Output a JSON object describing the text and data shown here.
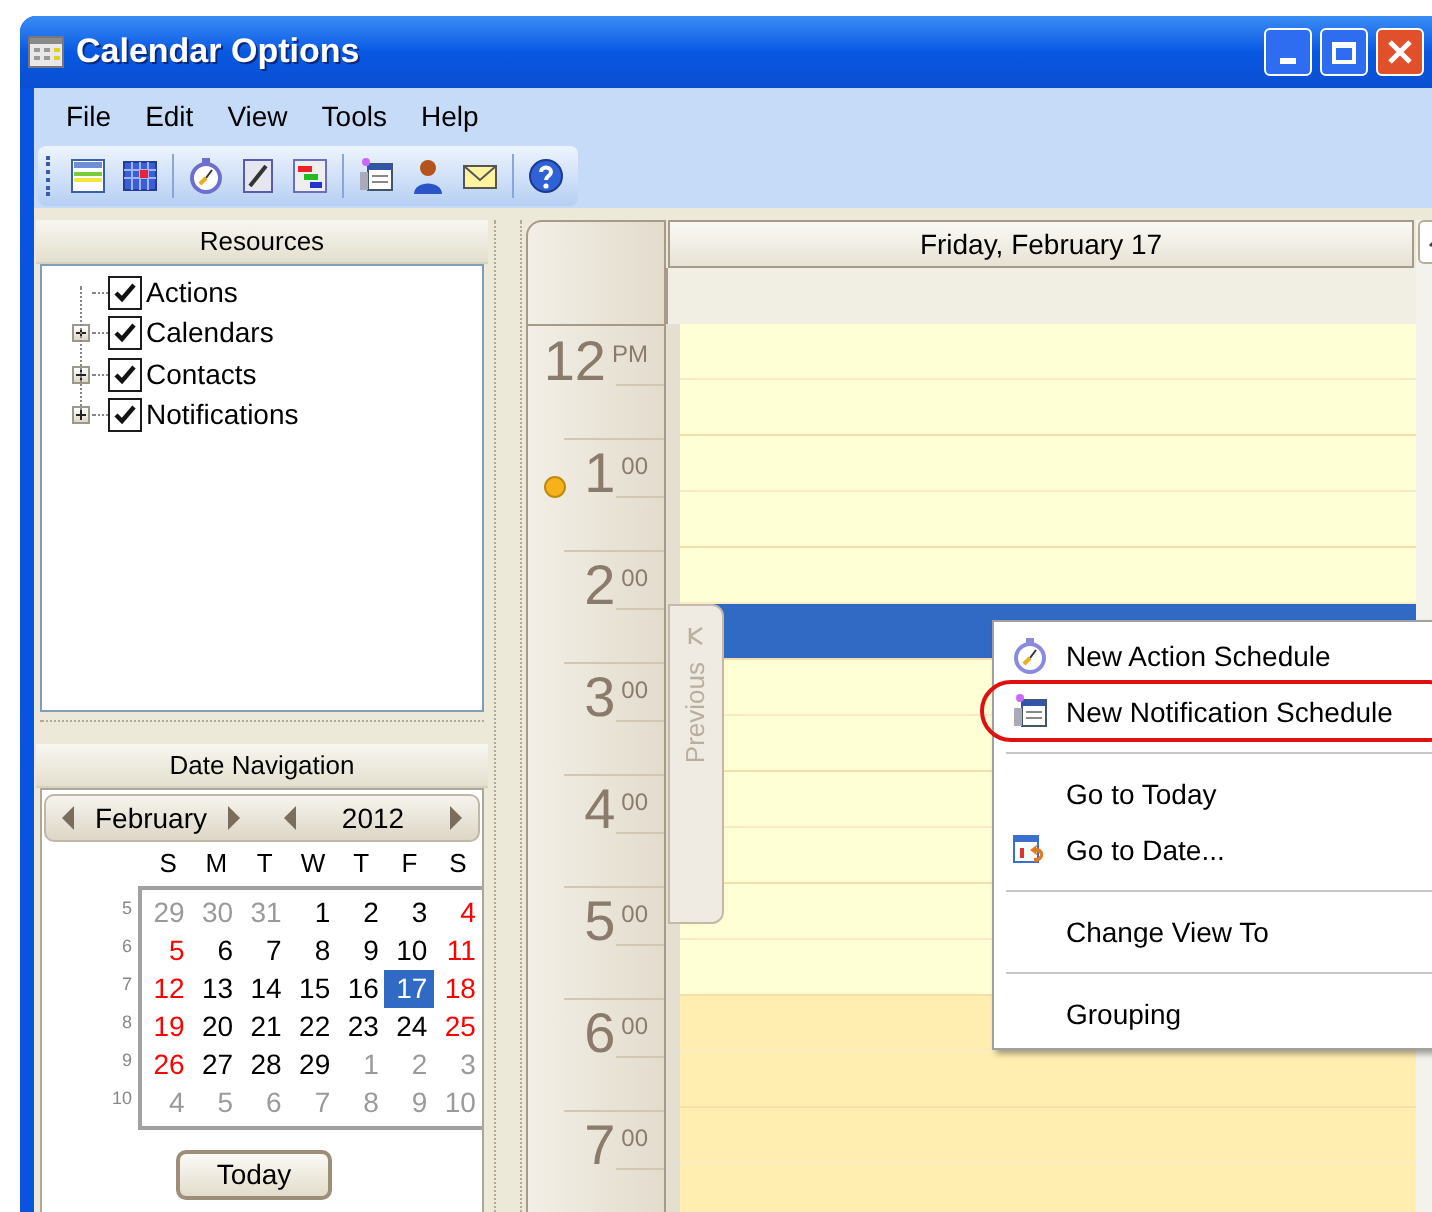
{
  "window": {
    "title": "Calendar Options"
  },
  "menu_bar": [
    "File",
    "Edit",
    "View",
    "Tools",
    "Help"
  ],
  "resources": {
    "title": "Resources",
    "items": [
      {
        "label": "Actions",
        "checked": true,
        "expandable": false
      },
      {
        "label": "Calendars",
        "checked": true,
        "expandable": true
      },
      {
        "label": "Contacts",
        "checked": true,
        "expandable": true
      },
      {
        "label": "Notifications",
        "checked": true,
        "expandable": true
      }
    ]
  },
  "date_navigation": {
    "title": "Date Navigation",
    "month": "February",
    "year": "2012",
    "weekdays": [
      "S",
      "M",
      "T",
      "W",
      "T",
      "F",
      "S"
    ],
    "weeks": [
      {
        "number": "5",
        "days": [
          {
            "text": "29",
            "kind": "muted",
            "selected": false
          },
          {
            "text": "30",
            "kind": "muted",
            "selected": false
          },
          {
            "text": "31",
            "kind": "muted",
            "selected": false
          },
          {
            "text": "1",
            "kind": "normal",
            "selected": false
          },
          {
            "text": "2",
            "kind": "normal",
            "selected": false
          },
          {
            "text": "3",
            "kind": "normal",
            "selected": false
          },
          {
            "text": "4",
            "kind": "weekend",
            "selected": false
          }
        ]
      },
      {
        "number": "6",
        "days": [
          {
            "text": "5",
            "kind": "weekend",
            "selected": false
          },
          {
            "text": "6",
            "kind": "normal",
            "selected": false
          },
          {
            "text": "7",
            "kind": "normal",
            "selected": false
          },
          {
            "text": "8",
            "kind": "normal",
            "selected": false
          },
          {
            "text": "9",
            "kind": "normal",
            "selected": false
          },
          {
            "text": "10",
            "kind": "normal",
            "selected": false
          },
          {
            "text": "11",
            "kind": "weekend",
            "selected": false
          }
        ]
      },
      {
        "number": "7",
        "days": [
          {
            "text": "12",
            "kind": "weekend",
            "selected": false
          },
          {
            "text": "13",
            "kind": "normal",
            "selected": false
          },
          {
            "text": "14",
            "kind": "normal",
            "selected": false
          },
          {
            "text": "15",
            "kind": "normal",
            "selected": false
          },
          {
            "text": "16",
            "kind": "normal",
            "selected": false
          },
          {
            "text": "17",
            "kind": "normal",
            "selected": true
          },
          {
            "text": "18",
            "kind": "weekend",
            "selected": false
          }
        ]
      },
      {
        "number": "8",
        "days": [
          {
            "text": "19",
            "kind": "weekend",
            "selected": false
          },
          {
            "text": "20",
            "kind": "normal",
            "selected": false
          },
          {
            "text": "21",
            "kind": "normal",
            "selected": false
          },
          {
            "text": "22",
            "kind": "normal",
            "selected": false
          },
          {
            "text": "23",
            "kind": "normal",
            "selected": false
          },
          {
            "text": "24",
            "kind": "normal",
            "selected": false
          },
          {
            "text": "25",
            "kind": "weekend",
            "selected": false
          }
        ]
      },
      {
        "number": "9",
        "days": [
          {
            "text": "26",
            "kind": "weekend",
            "selected": false
          },
          {
            "text": "27",
            "kind": "normal",
            "selected": false
          },
          {
            "text": "28",
            "kind": "normal",
            "selected": false
          },
          {
            "text": "29",
            "kind": "normal",
            "selected": false
          },
          {
            "text": "1",
            "kind": "muted",
            "selected": false
          },
          {
            "text": "2",
            "kind": "muted",
            "selected": false
          },
          {
            "text": "3",
            "kind": "muted",
            "selected": false
          }
        ]
      },
      {
        "number": "10",
        "days": [
          {
            "text": "4",
            "kind": "muted",
            "selected": false
          },
          {
            "text": "5",
            "kind": "muted",
            "selected": false
          },
          {
            "text": "6",
            "kind": "muted",
            "selected": false
          },
          {
            "text": "7",
            "kind": "muted",
            "selected": false
          },
          {
            "text": "8",
            "kind": "muted",
            "selected": false
          },
          {
            "text": "9",
            "kind": "muted",
            "selected": false
          },
          {
            "text": "10",
            "kind": "muted",
            "selected": false
          }
        ]
      }
    ],
    "today_button": "Today"
  },
  "day_view": {
    "header": "Friday, February 17",
    "hours": [
      {
        "hour": "12",
        "suffix": "PM"
      },
      {
        "hour": "1",
        "suffix": "00"
      },
      {
        "hour": "2",
        "suffix": "00"
      },
      {
        "hour": "3",
        "suffix": "00"
      },
      {
        "hour": "4",
        "suffix": "00"
      },
      {
        "hour": "5",
        "suffix": "00"
      },
      {
        "hour": "6",
        "suffix": "00"
      },
      {
        "hour": "7",
        "suffix": "00"
      }
    ],
    "slots": [
      {
        "selected": false,
        "working": true
      },
      {
        "selected": false,
        "working": true
      },
      {
        "selected": false,
        "working": true
      },
      {
        "selected": false,
        "working": true
      },
      {
        "selected": false,
        "working": true
      },
      {
        "selected": true,
        "working": true
      },
      {
        "selected": false,
        "working": true
      },
      {
        "selected": false,
        "working": true
      },
      {
        "selected": false,
        "working": true
      },
      {
        "selected": false,
        "working": true
      },
      {
        "selected": false,
        "working": true
      },
      {
        "selected": false,
        "working": true
      },
      {
        "selected": false,
        "working": false
      },
      {
        "selected": false,
        "working": false
      },
      {
        "selected": false,
        "working": false
      },
      {
        "selected": false,
        "working": false
      }
    ],
    "previous_tab": "Previous"
  },
  "context_menu": {
    "groups": [
      [
        {
          "label": "New Action Schedule",
          "highlighted": false
        },
        {
          "label": "New Notification Schedule",
          "highlighted": true
        }
      ],
      [
        {
          "label": "Go to Today",
          "highlighted": false
        },
        {
          "label": "Go to Date...",
          "highlighted": false
        }
      ],
      [
        {
          "label": "Change View To",
          "highlighted": false
        }
      ],
      [
        {
          "label": "Grouping",
          "highlighted": false
        }
      ]
    ]
  }
}
